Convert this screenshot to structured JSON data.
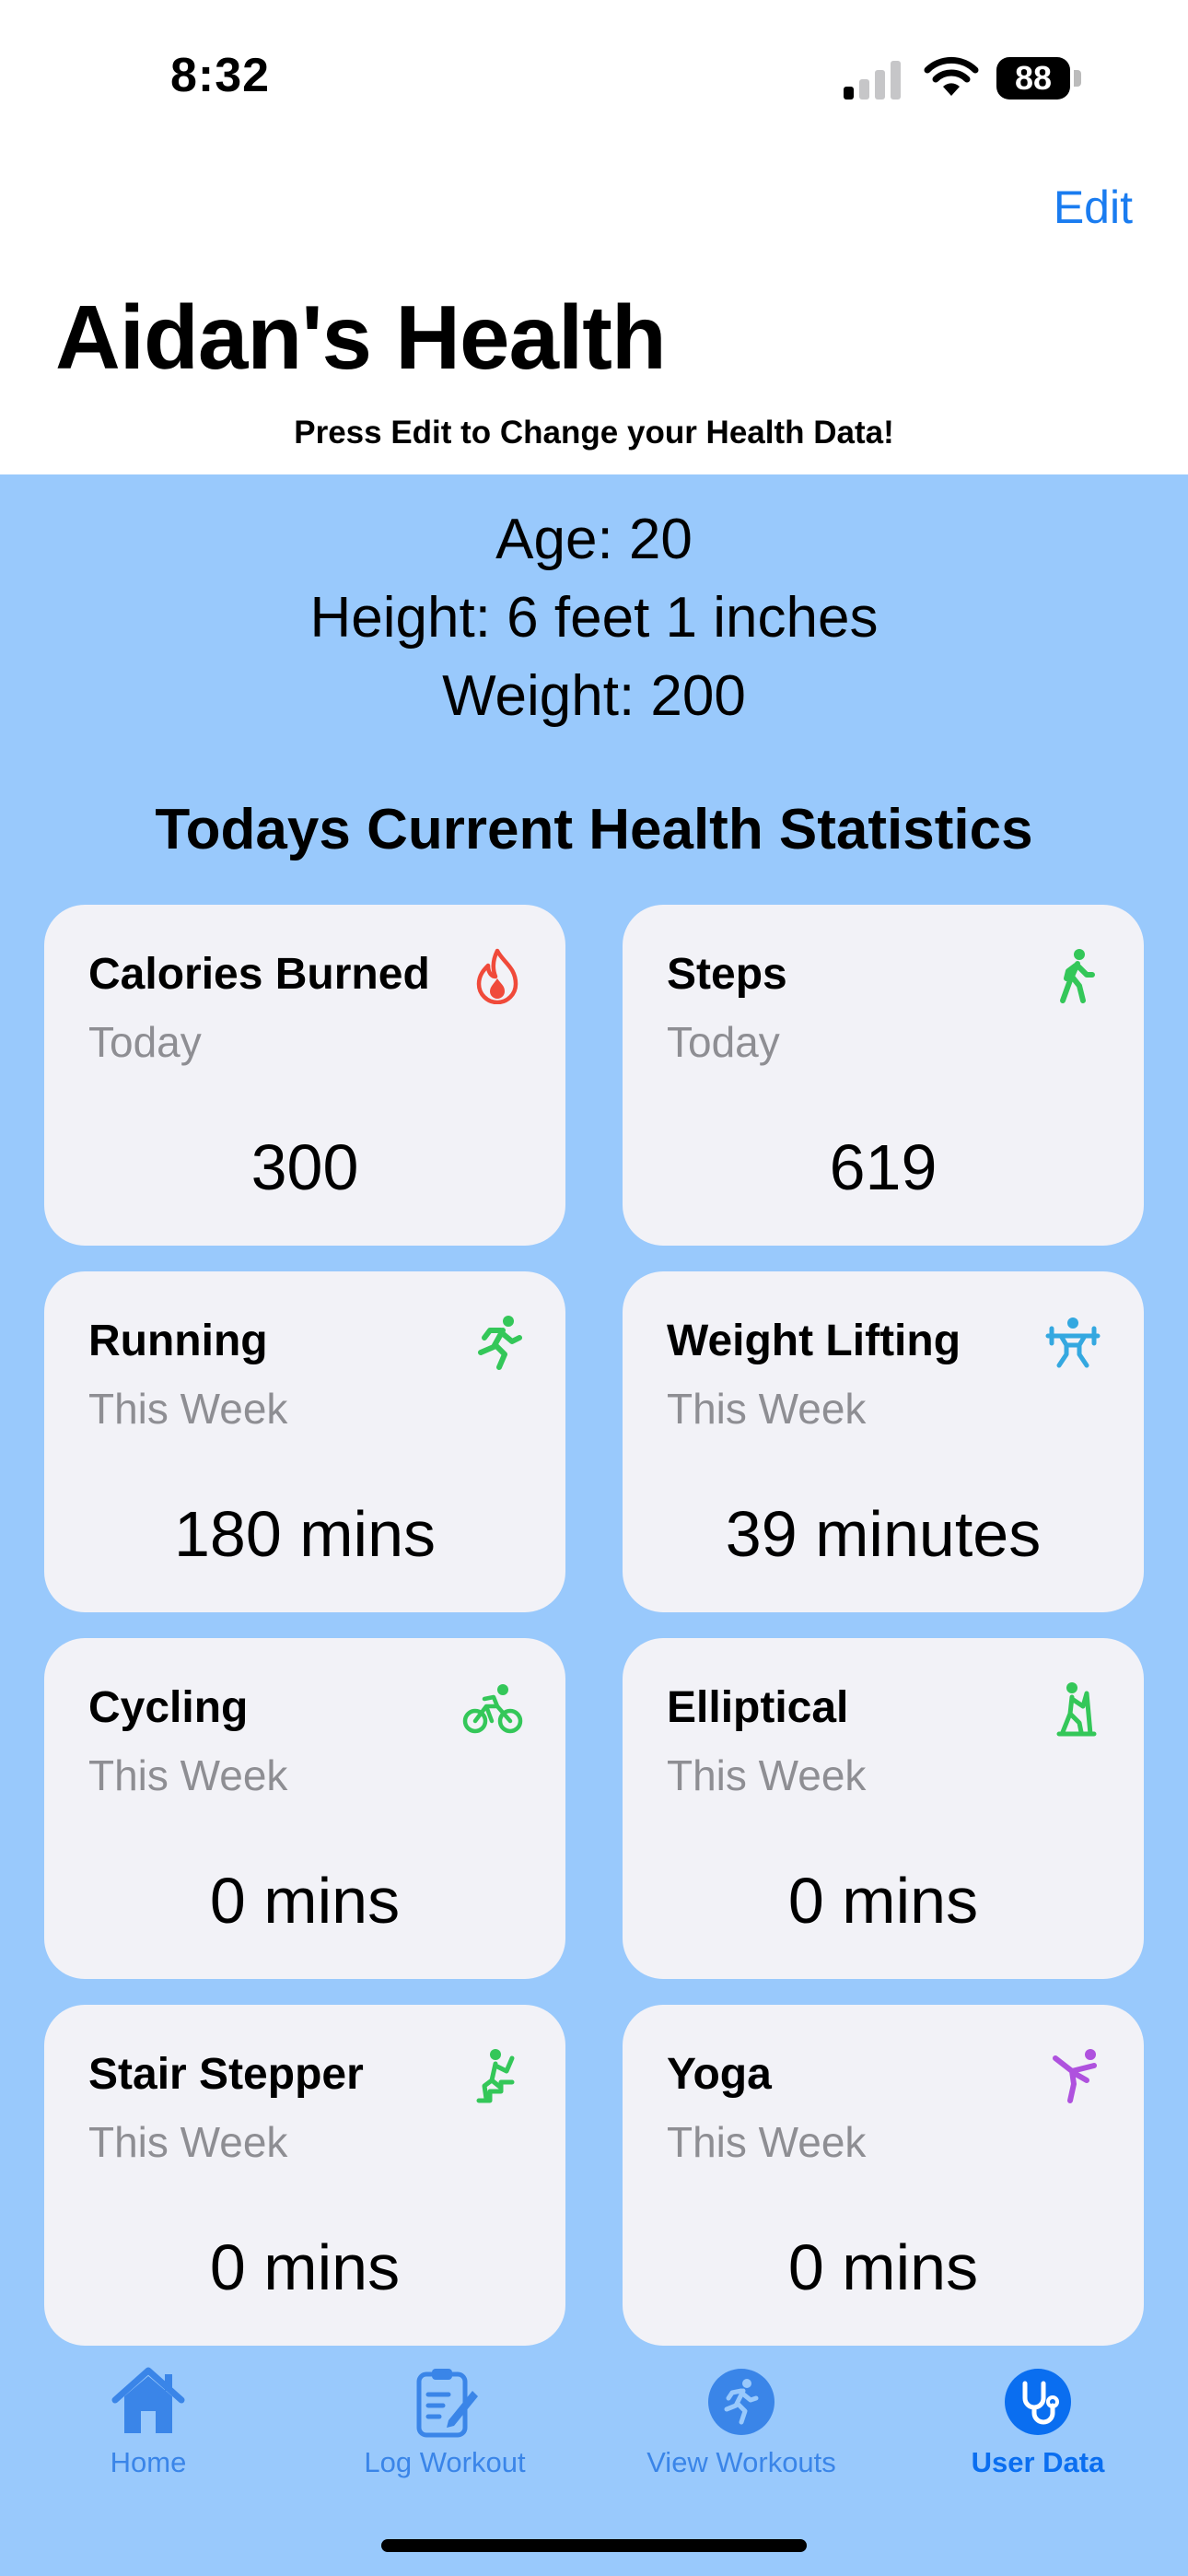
{
  "status_bar": {
    "time": "8:32",
    "battery": "88"
  },
  "header": {
    "edit_label": "Edit",
    "title": "Aidan's Health",
    "subtitle": "Press Edit to Change your Health Data!"
  },
  "profile": {
    "age": "Age: 20",
    "height": "Height: 6 feet 1 inches",
    "weight": "Weight: 200"
  },
  "stats_title": "Todays Current Health Statistics",
  "cards": [
    {
      "title": "Calories Burned",
      "period": "Today",
      "value": "300",
      "icon": "flame-icon",
      "color": "#f04a3a"
    },
    {
      "title": "Steps",
      "period": "Today",
      "value": "619",
      "icon": "walking-figure-icon",
      "color": "#34c759"
    },
    {
      "title": "Running",
      "period": "This Week",
      "value": "180 mins",
      "icon": "running-figure-icon",
      "color": "#34c759"
    },
    {
      "title": "Weight Lifting",
      "period": "This Week",
      "value": "39 minutes",
      "icon": "weightlifting-figure-icon",
      "color": "#34a8e0"
    },
    {
      "title": "Cycling",
      "period": "This Week",
      "value": "0 mins",
      "icon": "bicycle-icon",
      "color": "#34c759"
    },
    {
      "title": "Elliptical",
      "period": "This Week",
      "value": "0 mins",
      "icon": "elliptical-figure-icon",
      "color": "#34c759"
    },
    {
      "title": "Stair Stepper",
      "period": "This Week",
      "value": "0 mins",
      "icon": "stair-stepper-figure-icon",
      "color": "#34c759"
    },
    {
      "title": "Yoga",
      "period": "This Week",
      "value": "0 mins",
      "icon": "yoga-figure-icon",
      "color": "#af52de"
    }
  ],
  "tabs": [
    {
      "label": "Home",
      "icon": "house-icon"
    },
    {
      "label": "Log Workout",
      "icon": "clipboard-pencil-icon"
    },
    {
      "label": "View Workouts",
      "icon": "running-circle-icon"
    },
    {
      "label": "User Data",
      "icon": "stethoscope-circle-icon",
      "active": true
    }
  ],
  "colors": {
    "accent": "#1a7cf0",
    "content_background": "#99c9fc",
    "card_background": "#f2f2f7",
    "secondary_text": "#8e8e93"
  }
}
